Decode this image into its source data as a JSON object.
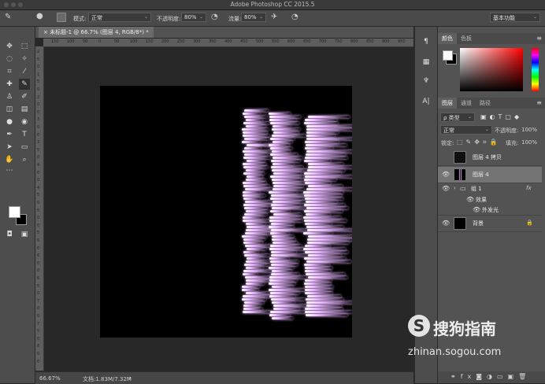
{
  "window": {
    "title": "Adobe Photoshop CC 2015.5"
  },
  "options_bar": {
    "mode_label": "模式:",
    "mode_value": "正常",
    "opacity_label": "不透明度:",
    "opacity_value": "80%",
    "flow_label": "流量:",
    "flow_value": "80%",
    "workspace": "基本功能"
  },
  "document": {
    "tab_title": "未标题-1 @ 66.7% (图层 4, RGB/8*) *",
    "ruler_top": [
      "150",
      "100",
      "50",
      "0",
      "50",
      "100",
      "150",
      "200",
      "250",
      "300",
      "350",
      "400",
      "450",
      "500",
      "550",
      "600",
      "650",
      "700",
      "750",
      "800",
      "850",
      "900",
      "950"
    ],
    "ruler_left": [
      "2",
      "5",
      "0",
      "1",
      "5",
      "0",
      "2",
      "0",
      "0",
      "3",
      "0",
      "0",
      "3",
      "5",
      "0",
      "4",
      "0",
      "0",
      "4",
      "5",
      "0",
      "5",
      "0",
      "0",
      "5",
      "5",
      "0",
      "6",
      "0",
      "0",
      "6",
      "5",
      "0",
      "7",
      "0",
      "0",
      "7",
      "5",
      "0",
      "8",
      "0",
      "0"
    ],
    "zoom": "66.67%",
    "doc_info": "文档:1.83M/7.32M"
  },
  "color_panel": {
    "tabs": [
      "颜色",
      "色板"
    ],
    "fg": "#ffffff",
    "bg": "#000000"
  },
  "layers_panel": {
    "tabs": [
      "图层",
      "通道",
      "路径"
    ],
    "filter_label": "ρ 类型",
    "blend_mode": "正常",
    "opacity_label": "不透明度:",
    "opacity_value": "100%",
    "lock_label": "锁定:",
    "fill_label": "填充:",
    "fill_value": "100%",
    "layers": [
      {
        "name": "图层 4 拷贝",
        "visible": false
      },
      {
        "name": "图层 4",
        "visible": true,
        "selected": true
      },
      {
        "name": "组 1",
        "visible": true,
        "fx": "fx"
      },
      {
        "name": "效果",
        "visible": true
      },
      {
        "name": "外发光",
        "visible": true
      },
      {
        "name": "背景",
        "visible": true,
        "locked": true
      }
    ]
  },
  "watermark": {
    "brand": "搜狗指南",
    "url": "zhinan.sogou.com"
  },
  "accent": {
    "glow": "#e8b8ff",
    "glow_core": "#ffffff"
  }
}
